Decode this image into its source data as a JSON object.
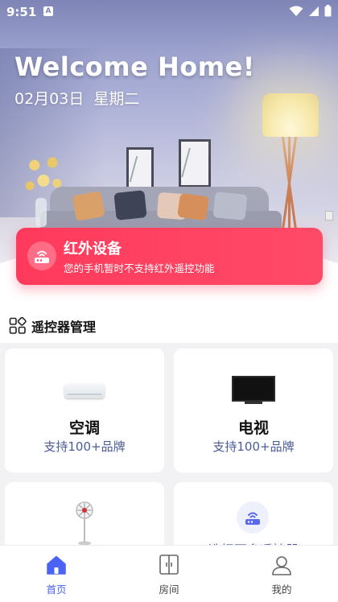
{
  "status_bar": {
    "time": "9:51",
    "notification_badge": "A"
  },
  "hero": {
    "welcome": "Welcome  Home!",
    "date": "02月03日",
    "weekday": "星期二"
  },
  "ir_card": {
    "title": "红外设备",
    "description": "您的手机暂时不支持红外遥控功能",
    "color": "#ff3a5c"
  },
  "remote_section": {
    "title": "遥控器管理"
  },
  "devices": [
    {
      "name": "空调",
      "subtitle": "支持100+品牌"
    },
    {
      "name": "电视",
      "subtitle": "支持100+品牌"
    }
  ],
  "more_devices": {
    "label": "选择更多遥控器"
  },
  "bottom_nav": {
    "items": [
      {
        "label": "首页",
        "active": true
      },
      {
        "label": "房间",
        "active": false
      },
      {
        "label": "我的",
        "active": false
      }
    ],
    "accent": "#4a63f5"
  }
}
